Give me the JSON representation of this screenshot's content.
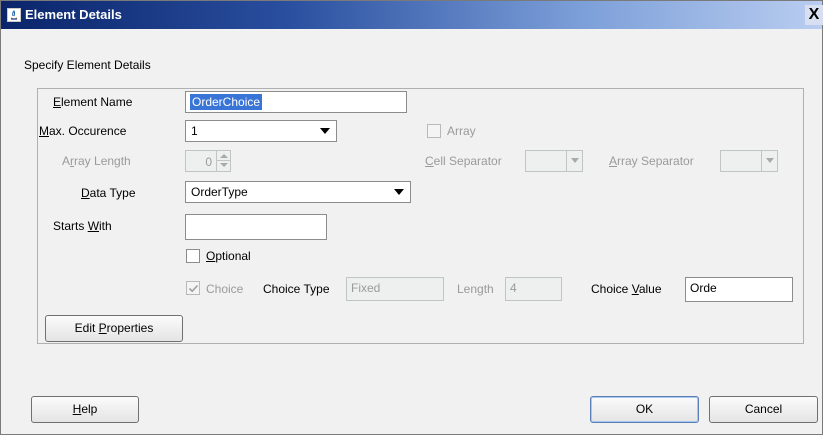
{
  "window": {
    "title": "Element Details",
    "close_label": "X"
  },
  "section_title": "Specify Element Details",
  "form": {
    "element_name": {
      "label_pre": "",
      "label_mn": "E",
      "label_post": "lement Name",
      "value": "OrderChoice"
    },
    "max_occurence": {
      "label_pre": "",
      "label_mn": "M",
      "label_post": "ax. Occurence",
      "value": "1"
    },
    "array": {
      "label": "Array",
      "checked": false
    },
    "array_length": {
      "label_pre": "A",
      "label_mn": "r",
      "label_post": "ray Length",
      "value": "0"
    },
    "cell_separator": {
      "label_pre": "",
      "label_mn": "C",
      "label_post": "ell Separator",
      "value": ""
    },
    "array_separator": {
      "label_pre": "",
      "label_mn": "A",
      "label_post": "rray Separator",
      "value": ""
    },
    "data_type": {
      "label_pre": "",
      "label_mn": "D",
      "label_post": "ata Type",
      "value": "OrderType"
    },
    "starts_with": {
      "label_pre": "Starts ",
      "label_mn": "W",
      "label_post": "ith",
      "value": ""
    },
    "optional": {
      "label_pre": "",
      "label_mn": "O",
      "label_post": "ptional",
      "checked": false
    },
    "choice": {
      "label": "Choice",
      "checked": true
    },
    "choice_type": {
      "label": "Choice Type",
      "value": "Fixed"
    },
    "length": {
      "label": "Length",
      "value": "4"
    },
    "choice_value": {
      "label_pre": "Choice ",
      "label_mn": "V",
      "label_post": "alue",
      "value": "Orde"
    }
  },
  "buttons": {
    "edit_properties": {
      "pre": "Edit ",
      "mn": "P",
      "post": "roperties"
    },
    "help": {
      "pre": "",
      "mn": "H",
      "post": "elp"
    },
    "ok": "OK",
    "cancel": "Cancel"
  }
}
